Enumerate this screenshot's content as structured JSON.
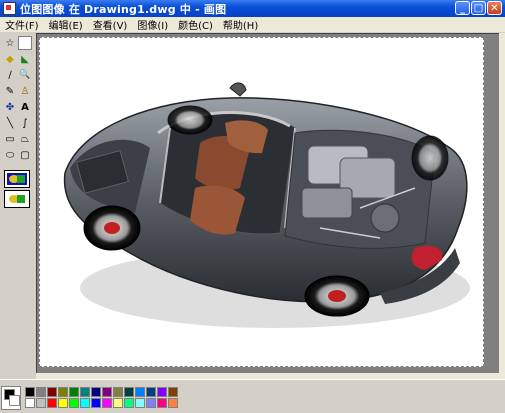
{
  "window": {
    "title": "位图图像 在 Drawing1.dwg 中 - 画图"
  },
  "menu": [
    "文件(F)",
    "编辑(E)",
    "查看(V)",
    "图像(I)",
    "颜色(C)",
    "帮助(H)"
  ],
  "window_controls": {
    "minimize": "_",
    "maximize": "□",
    "close": "✕"
  },
  "tools": [
    {
      "name": "free-select-icon",
      "glyph": "☆"
    },
    {
      "name": "rect-select-icon",
      "glyph": ""
    },
    {
      "name": "eraser-icon",
      "glyph": "◆"
    },
    {
      "name": "fill-icon",
      "glyph": "◣"
    },
    {
      "name": "color-picker-icon",
      "glyph": "∕"
    },
    {
      "name": "magnifier-icon",
      "glyph": "🔍"
    },
    {
      "name": "pencil-icon",
      "glyph": "✎"
    },
    {
      "name": "brush-icon",
      "glyph": "♙"
    },
    {
      "name": "airbrush-icon",
      "glyph": "✤"
    },
    {
      "name": "text-icon",
      "glyph": "A"
    },
    {
      "name": "line-icon",
      "glyph": "╲"
    },
    {
      "name": "curve-icon",
      "glyph": "∫"
    },
    {
      "name": "rectangle-icon",
      "glyph": "▭"
    },
    {
      "name": "polygon-icon",
      "glyph": "⏢"
    },
    {
      "name": "ellipse-icon",
      "glyph": "⬭"
    },
    {
      "name": "rounded-rect-icon",
      "glyph": "▢"
    }
  ],
  "palette_top": [
    "#000000",
    "#808080",
    "#800000",
    "#808000",
    "#008000",
    "#008080",
    "#000080",
    "#800080",
    "#808040",
    "#004040",
    "#0080ff",
    "#004080",
    "#8000ff",
    "#804000"
  ],
  "palette_bottom": [
    "#ffffff",
    "#c0c0c0",
    "#ff0000",
    "#ffff00",
    "#00ff00",
    "#00ffff",
    "#0000ff",
    "#ff00ff",
    "#ffff80",
    "#00ff80",
    "#80ffff",
    "#8080ff",
    "#ff0080",
    "#ff8040"
  ],
  "colors": {
    "foreground": "#000000",
    "background": "#ffffff",
    "titlebar": "#0a4fd6"
  }
}
